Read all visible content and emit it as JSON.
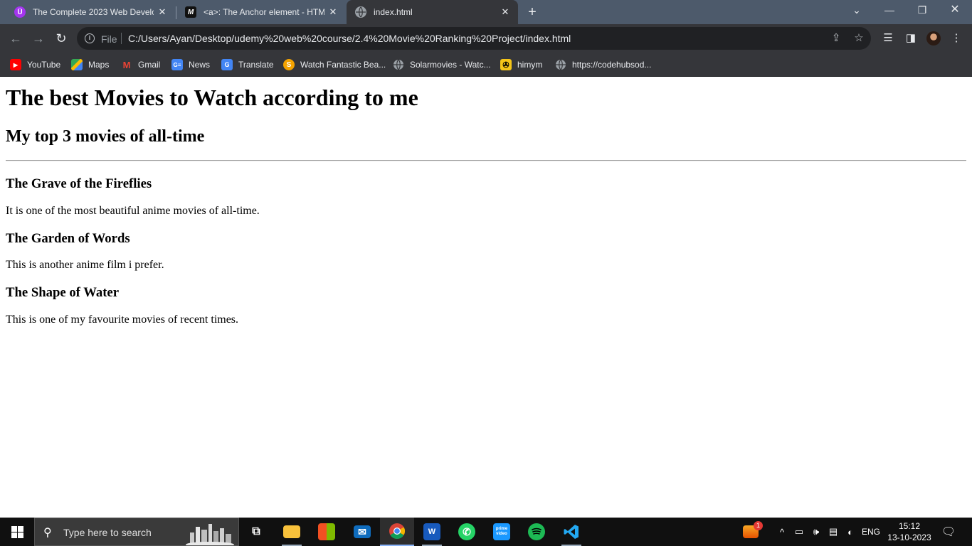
{
  "browser": {
    "tabs": [
      {
        "title": "The Complete 2023 Web Develo",
        "favicon": "udemy-icon",
        "favicon_text": "Ü",
        "active": false
      },
      {
        "title": "<a>: The Anchor element - HTM",
        "favicon": "mdn-icon",
        "favicon_text": "M",
        "active": false
      },
      {
        "title": "index.html",
        "favicon": "globe-icon",
        "favicon_text": "",
        "active": true
      }
    ],
    "address_bar": {
      "scheme_label": "File",
      "url": "C:/Users/Ayan/Desktop/udemy%20web%20course/2.4%20Movie%20Ranking%20Project/index.html"
    },
    "bookmarks": [
      {
        "label": "YouTube",
        "icon": "youtube-icon",
        "color": "#ff0000"
      },
      {
        "label": "Maps",
        "icon": "maps-icon",
        "color": "#34a853"
      },
      {
        "label": "Gmail",
        "icon": "gmail-icon",
        "color": "#ea4335"
      },
      {
        "label": "News",
        "icon": "news-icon",
        "color": "#4285f4"
      },
      {
        "label": "Translate",
        "icon": "translate-icon",
        "color": "#4285f4"
      },
      {
        "label": "Watch Fantastic Bea...",
        "icon": "site-s-icon",
        "color": "#f4a300"
      },
      {
        "label": "Solarmovies - Watc...",
        "icon": "globe-icon",
        "color": "#9aa0a6"
      },
      {
        "label": "himym",
        "icon": "film-reel-icon",
        "color": "#f5c518"
      },
      {
        "label": "https://codehubsod...",
        "icon": "globe-icon",
        "color": "#9aa0a6"
      }
    ]
  },
  "page": {
    "heading": "The best Movies to Watch according to me",
    "subheading": "My top 3 movies of all-time",
    "movies": [
      {
        "title": "The Grave of the Fireflies",
        "description": "It is one of the most beautiful anime movies of all-time."
      },
      {
        "title": "The Garden of Words",
        "description": "This is another anime film i prefer."
      },
      {
        "title": "The Shape of Water",
        "description": "This is one of my favourite movies of recent times."
      }
    ]
  },
  "taskbar": {
    "search_placeholder": "Type here to search",
    "apps": [
      {
        "name": "task-view-icon"
      },
      {
        "name": "file-explorer-icon"
      },
      {
        "name": "microsoft-store-icon"
      },
      {
        "name": "mail-icon"
      },
      {
        "name": "chrome-icon",
        "active": true
      },
      {
        "name": "word-icon",
        "label": "W"
      },
      {
        "name": "whatsapp-icon"
      },
      {
        "name": "prime-video-icon",
        "label": "prime video"
      },
      {
        "name": "spotify-icon"
      },
      {
        "name": "vscode-icon"
      }
    ],
    "tray": {
      "notification_badge": "1",
      "language": "ENG",
      "time": "15:12",
      "date": "13-10-2023"
    }
  }
}
